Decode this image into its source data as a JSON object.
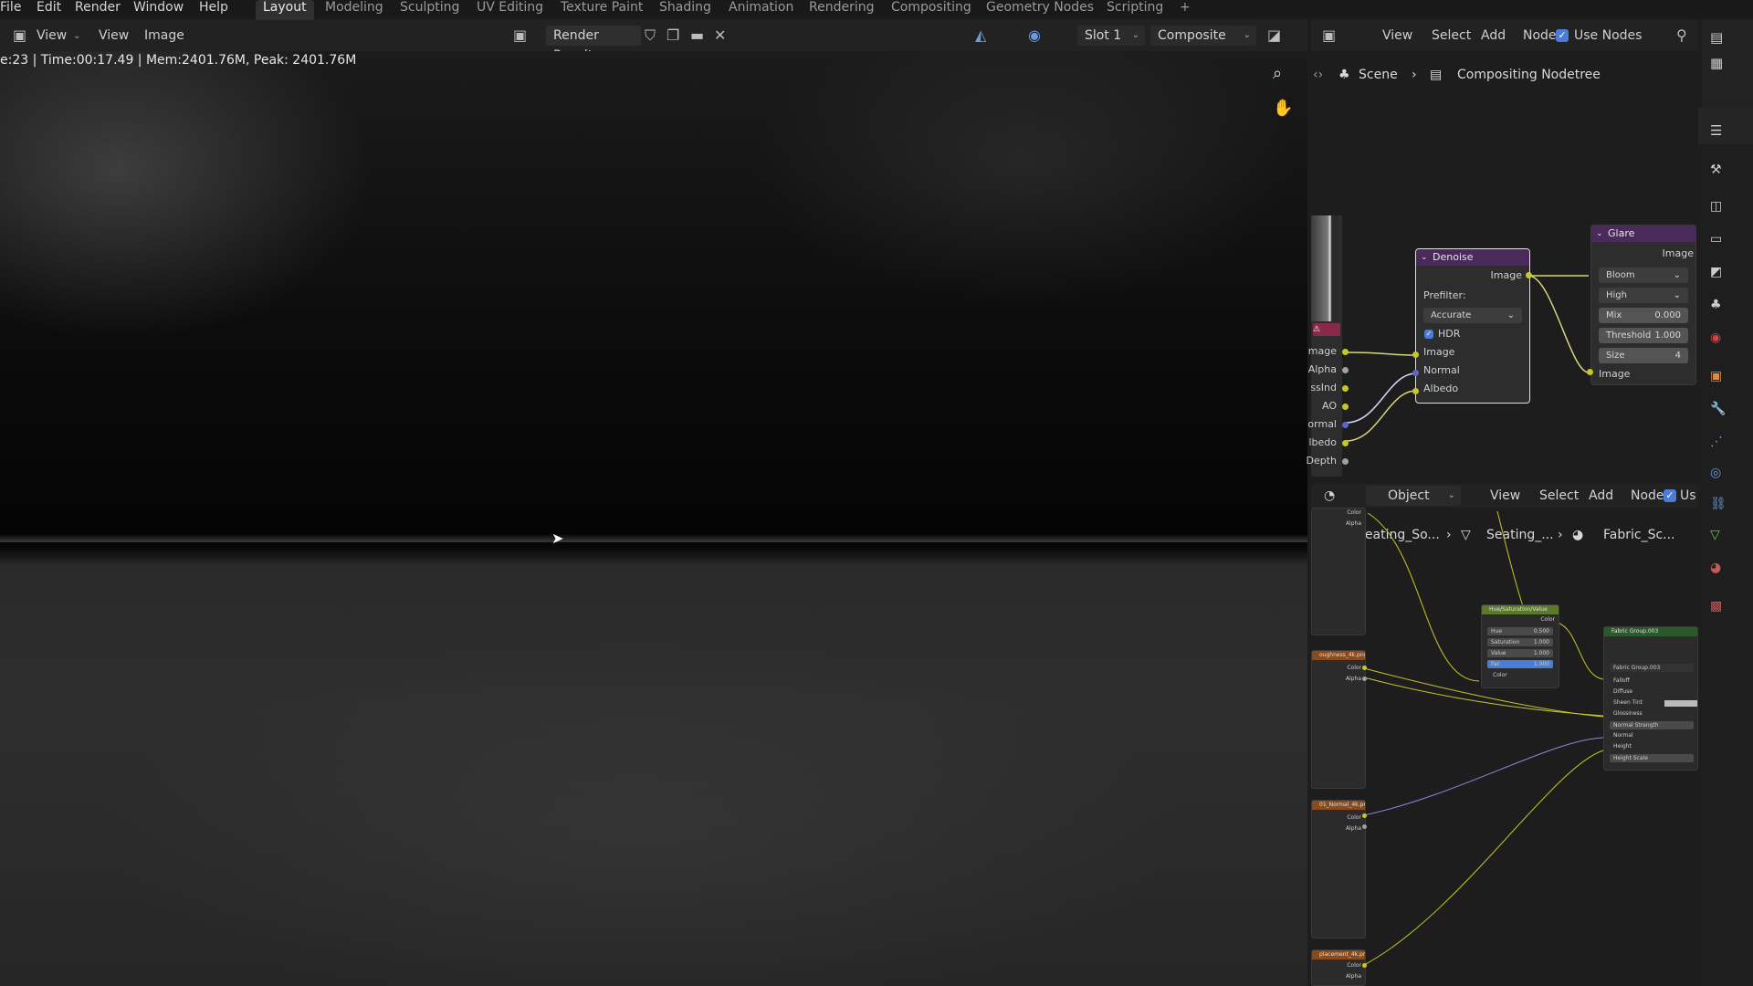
{
  "menubar": {
    "menus": [
      "File",
      "Edit",
      "Render",
      "Window",
      "Help"
    ],
    "workspaces": [
      "Layout",
      "Modeling",
      "Sculpting",
      "UV Editing",
      "Texture Paint",
      "Shading",
      "Animation",
      "Rendering",
      "Compositing",
      "Geometry Nodes",
      "Scripting"
    ],
    "active_workspace": "Layout",
    "add_tab": "+"
  },
  "image_editor": {
    "view_menu": "View",
    "menus": [
      "View",
      "Image"
    ],
    "image_name": "Render Result",
    "slot": "Slot 1",
    "layer": "Composite",
    "status": "e:23 | Time:00:17.49 | Mem:2401.76M, Peak: 2401.76M"
  },
  "compositor": {
    "menus": [
      "View",
      "Select",
      "Add",
      "Node"
    ],
    "use_nodes_label": "Use Nodes",
    "breadcrumb": [
      "Scene",
      "Compositing Nodetree"
    ],
    "render_layers_outputs": [
      "mage",
      "Alpha",
      "ssInd",
      "AO",
      "ormal",
      "lbedo",
      "Depth"
    ],
    "denoise": {
      "title": "Denoise",
      "output": "Image",
      "prefilter_label": "Prefilter:",
      "prefilter_value": "Accurate",
      "hdr_label": "HDR",
      "inputs": [
        "Image",
        "Normal",
        "Albedo"
      ]
    },
    "glare": {
      "title": "Glare",
      "output": "Image",
      "type": "Bloom",
      "quality": "High",
      "mix_label": "Mix",
      "mix_value": "0.000",
      "threshold_label": "Threshold",
      "threshold_value": "1.000",
      "size_label": "Size",
      "size_value": "4",
      "input": "Image"
    }
  },
  "shader_editor": {
    "mode": "Object",
    "menus": [
      "View",
      "Select",
      "Add",
      "Node"
    ],
    "use_nodes_label": "Us",
    "breadcrumb": [
      "Seating_So...",
      "Seating_...",
      "Fabric_Sc..."
    ],
    "texture_nodes": [
      {
        "title": "oughness_4k.png",
        "outputs": [
          "Color",
          "Alpha"
        ]
      },
      {
        "title": "01_Normal_4k.png",
        "outputs": [
          "Color",
          "Alpha"
        ]
      },
      {
        "title": "placement_4k.png",
        "outputs": [
          "Color",
          "Alpha"
        ]
      }
    ],
    "top_outputs": [
      "Color",
      "Alpha"
    ],
    "hsv_node": {
      "title": "Hue/Saturation/Value",
      "output": "Color",
      "fields": [
        {
          "label": "Hue",
          "value": "0.500"
        },
        {
          "label": "Saturation",
          "value": "1.000"
        },
        {
          "label": "Value",
          "value": "1.000"
        },
        {
          "label": "Fac",
          "value": "1.000"
        }
      ],
      "input": "Color"
    },
    "group_node": {
      "title": "Fabric Group.003",
      "datablock": "Fabric Group.003",
      "inputs": [
        "Falloff",
        "Diffuse",
        "Sheen Tint",
        "Glossiness",
        "Normal Strength",
        "Normal",
        "Height",
        "Height Scale"
      ]
    }
  },
  "colors": {
    "socket_yellow": "#c7c729",
    "socket_gray": "#a1a1a1",
    "socket_purple": "#6363c7",
    "accent_blue": "#4a7ed6",
    "filter_node_header": "#4a2a5a",
    "texture_node_header": "#8a4a1a",
    "converter_node_header": "#5a7a2a",
    "group_node_header": "#2a5a2a"
  },
  "icons": [
    "image-editor-icon",
    "shield-icon",
    "duplicate-icon",
    "folder-icon",
    "close-icon",
    "zoom-icon",
    "hand-icon",
    "node-editor-icon",
    "pin-icon",
    "scene-icon",
    "nodetree-icon"
  ]
}
